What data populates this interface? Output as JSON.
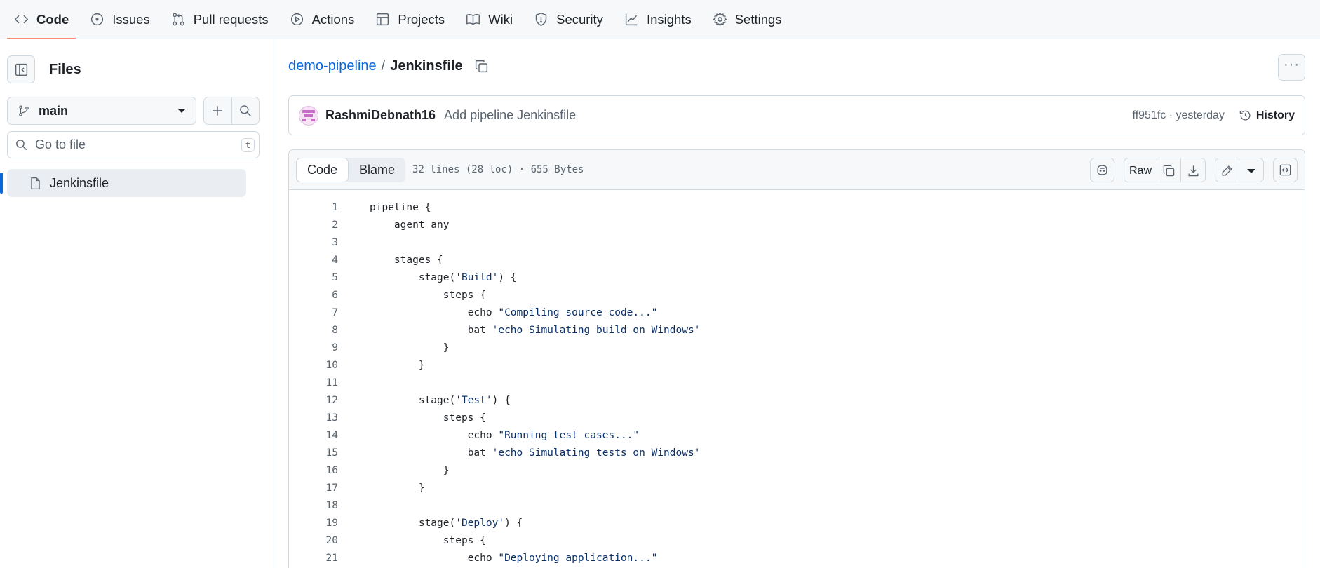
{
  "nav": {
    "tabs": [
      {
        "label": "Code",
        "icon": "code-icon",
        "active": true
      },
      {
        "label": "Issues",
        "icon": "issue-icon"
      },
      {
        "label": "Pull requests",
        "icon": "pull-request-icon"
      },
      {
        "label": "Actions",
        "icon": "play-icon"
      },
      {
        "label": "Projects",
        "icon": "table-icon"
      },
      {
        "label": "Wiki",
        "icon": "book-icon"
      },
      {
        "label": "Security",
        "icon": "shield-icon"
      },
      {
        "label": "Insights",
        "icon": "graph-icon"
      },
      {
        "label": "Settings",
        "icon": "gear-icon"
      }
    ]
  },
  "sidebar": {
    "title": "Files",
    "branch": "main",
    "search_placeholder": "Go to file",
    "search_shortcut": "t",
    "files": [
      {
        "name": "Jenkinsfile",
        "selected": true
      }
    ]
  },
  "breadcrumb": {
    "repo": "demo-pipeline",
    "separator": "/",
    "file": "Jenkinsfile"
  },
  "commit": {
    "author": "RashmiDebnath16",
    "message": "Add pipeline Jenkinsfile",
    "meta": "ff951fc · yesterday",
    "history_label": "History"
  },
  "file_view": {
    "tabs": [
      "Code",
      "Blame"
    ],
    "active_tab": "Code",
    "stats": "32 lines (28 loc) · 655 Bytes",
    "raw_label": "Raw"
  },
  "code_lines": [
    {
      "n": "1",
      "indent": 0,
      "pre": "pipeline {",
      "str": "",
      "post": ""
    },
    {
      "n": "2",
      "indent": 4,
      "pre": "agent any",
      "str": "",
      "post": ""
    },
    {
      "n": "3",
      "indent": 0,
      "pre": "",
      "str": "",
      "post": ""
    },
    {
      "n": "4",
      "indent": 4,
      "pre": "stages {",
      "str": "",
      "post": ""
    },
    {
      "n": "5",
      "indent": 8,
      "pre": "stage(",
      "str": "'Build'",
      "post": ") {"
    },
    {
      "n": "6",
      "indent": 12,
      "pre": "steps {",
      "str": "",
      "post": ""
    },
    {
      "n": "7",
      "indent": 16,
      "pre": "echo ",
      "str": "\"Compiling source code...\"",
      "post": ""
    },
    {
      "n": "8",
      "indent": 16,
      "pre": "bat ",
      "str": "'echo Simulating build on Windows'",
      "post": ""
    },
    {
      "n": "9",
      "indent": 12,
      "pre": "}",
      "str": "",
      "post": ""
    },
    {
      "n": "10",
      "indent": 8,
      "pre": "}",
      "str": "",
      "post": ""
    },
    {
      "n": "11",
      "indent": 0,
      "pre": "",
      "str": "",
      "post": ""
    },
    {
      "n": "12",
      "indent": 8,
      "pre": "stage(",
      "str": "'Test'",
      "post": ") {"
    },
    {
      "n": "13",
      "indent": 12,
      "pre": "steps {",
      "str": "",
      "post": ""
    },
    {
      "n": "14",
      "indent": 16,
      "pre": "echo ",
      "str": "\"Running test cases...\"",
      "post": ""
    },
    {
      "n": "15",
      "indent": 16,
      "pre": "bat ",
      "str": "'echo Simulating tests on Windows'",
      "post": ""
    },
    {
      "n": "16",
      "indent": 12,
      "pre": "}",
      "str": "",
      "post": ""
    },
    {
      "n": "17",
      "indent": 8,
      "pre": "}",
      "str": "",
      "post": ""
    },
    {
      "n": "18",
      "indent": 0,
      "pre": "",
      "str": "",
      "post": ""
    },
    {
      "n": "19",
      "indent": 8,
      "pre": "stage(",
      "str": "'Deploy'",
      "post": ") {"
    },
    {
      "n": "20",
      "indent": 12,
      "pre": "steps {",
      "str": "",
      "post": ""
    },
    {
      "n": "21",
      "indent": 16,
      "pre": "echo ",
      "str": "\"Deploying application...\"",
      "post": ""
    }
  ],
  "colors": {
    "accent": "#0969da",
    "tab_underline": "#fd8c73",
    "string": "#0a3069"
  }
}
